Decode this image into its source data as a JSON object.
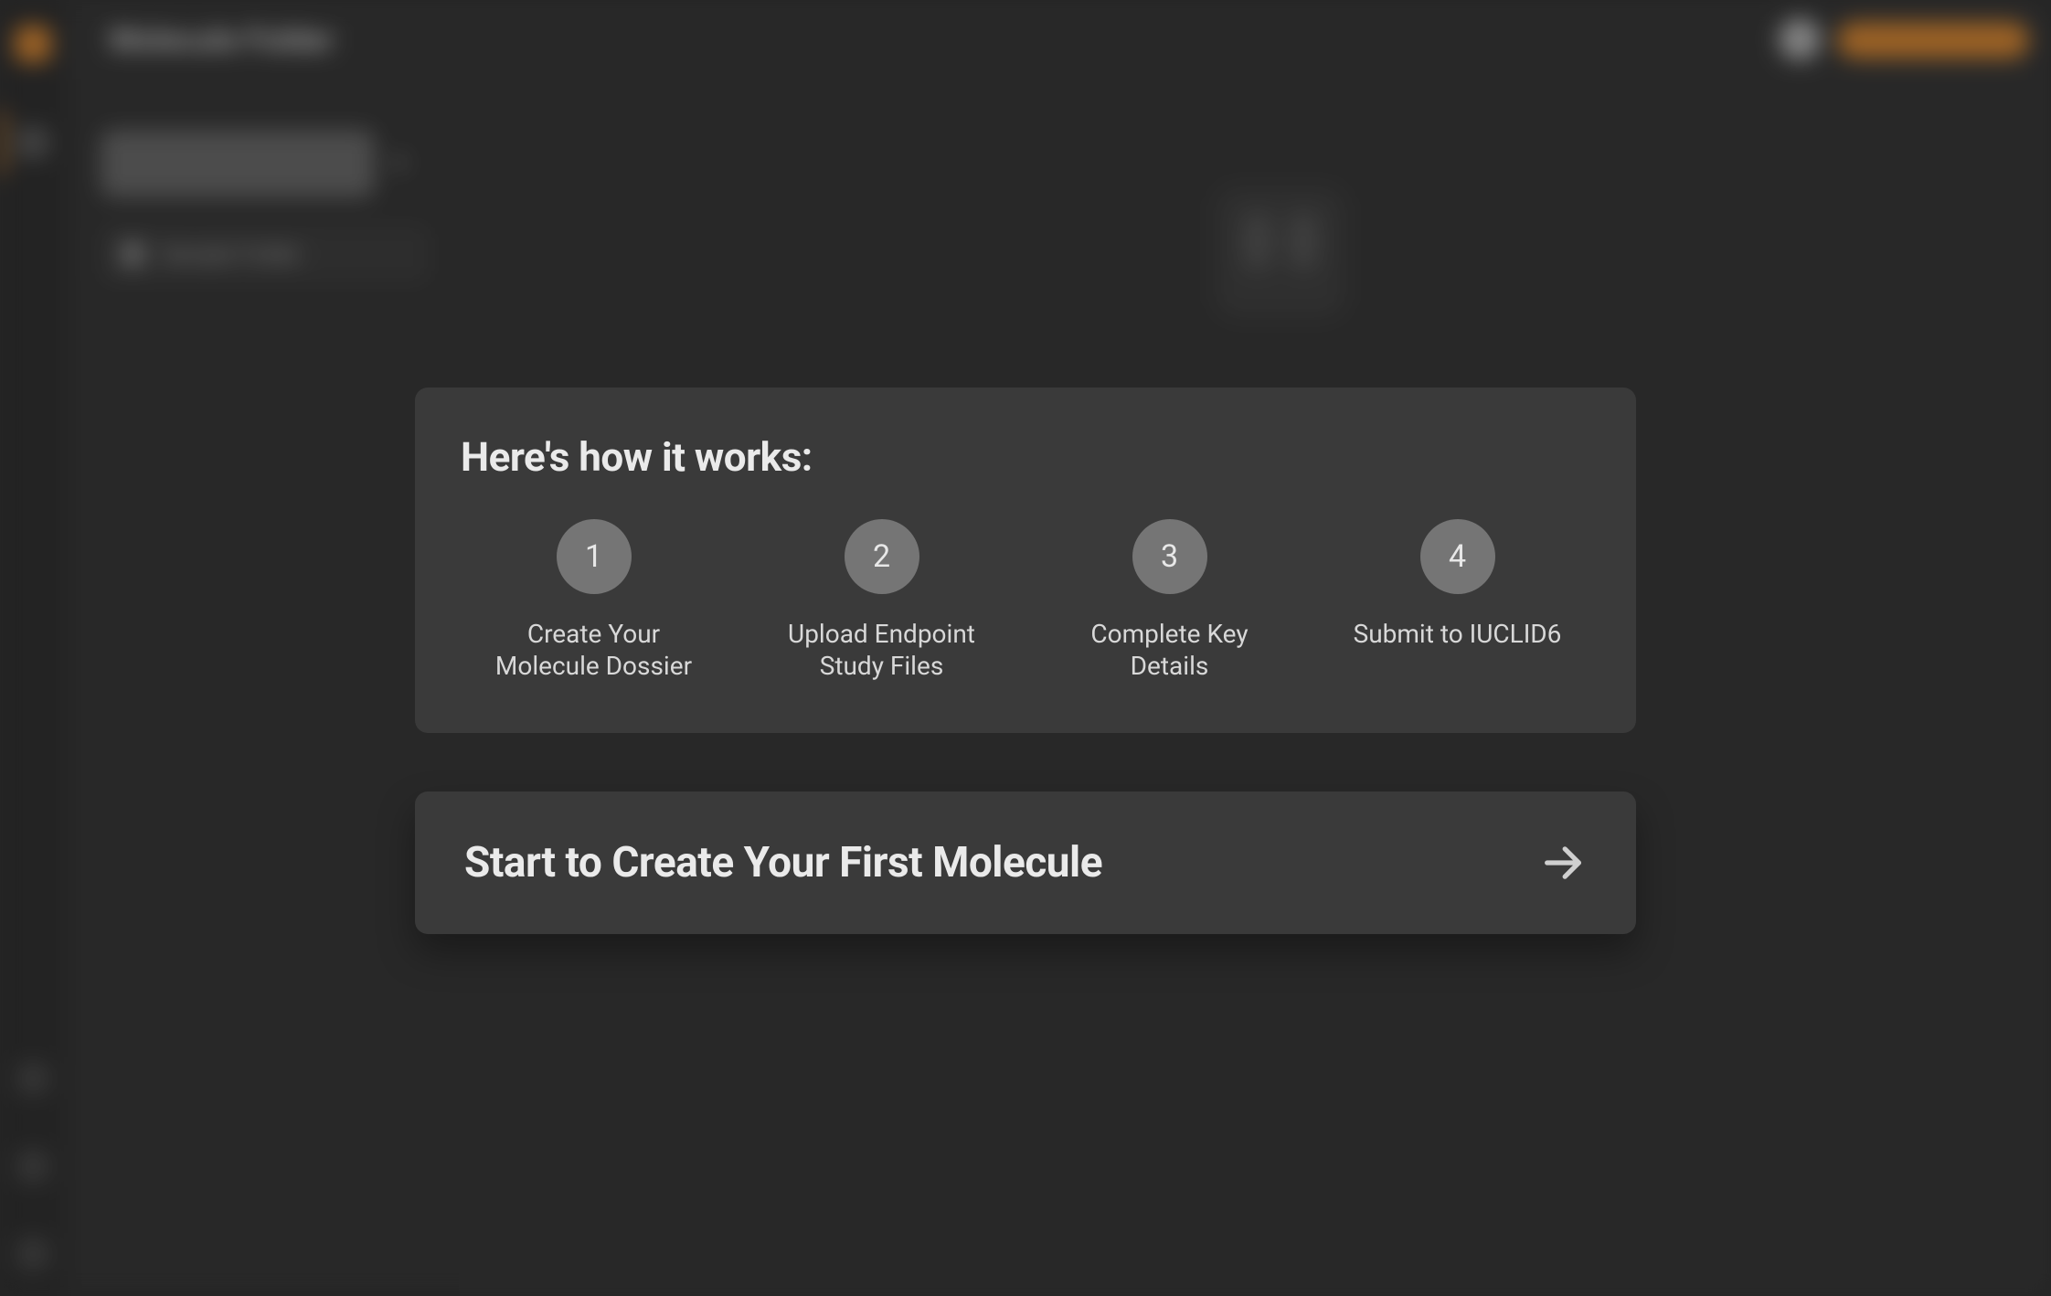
{
  "page": {
    "title": "Molecule Folder"
  },
  "sidebar": {
    "new_button_label": "New Molecule",
    "folder_label": "Sample Folder"
  },
  "modal": {
    "howit_title": "Here's how it works:",
    "steps": [
      {
        "num": "1",
        "label": "Create Your Molecule Dossier"
      },
      {
        "num": "2",
        "label": "Upload Endpoint Study Files"
      },
      {
        "num": "3",
        "label": "Complete Key Details"
      },
      {
        "num": "4",
        "label": "Submit to IUCLID6"
      }
    ],
    "start_title": "Start to Create Your First Molecule"
  }
}
